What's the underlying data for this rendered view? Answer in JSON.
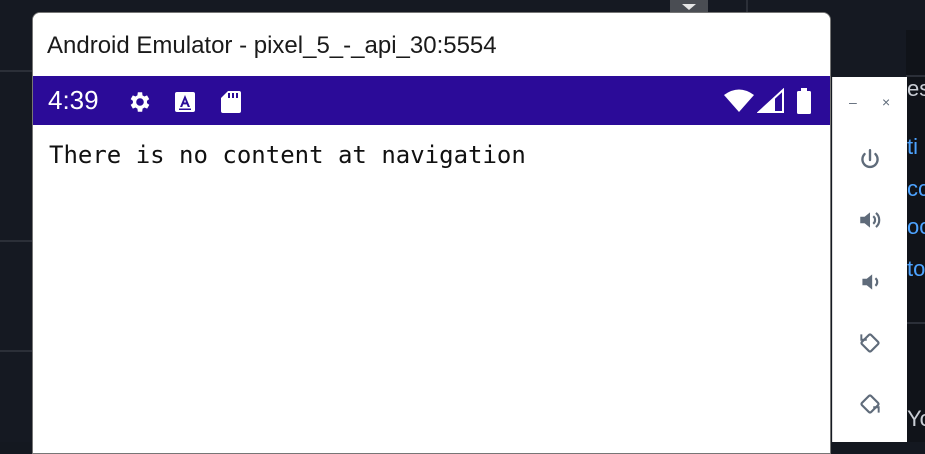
{
  "window": {
    "title": "Android Emulator - pixel_5_-_api_30:5554"
  },
  "status_bar": {
    "time": "4:39",
    "left_icons": [
      "gear-icon",
      "text-a-icon",
      "sd-card-icon"
    ],
    "right_icons": [
      "wifi-icon",
      "signal-icon",
      "battery-icon"
    ],
    "background_color": "#2b0b98"
  },
  "app": {
    "message": "There is no content at navigation"
  },
  "toolbar": {
    "minimize_label": "–",
    "close_label": "×",
    "buttons": [
      "power-icon",
      "volume-up-icon",
      "volume-down-icon",
      "rotate-left-icon",
      "rotate-right-icon"
    ]
  },
  "background_peek": {
    "lines": [
      "es",
      "ti",
      "cc",
      "oc",
      "to",
      "Yo"
    ]
  }
}
